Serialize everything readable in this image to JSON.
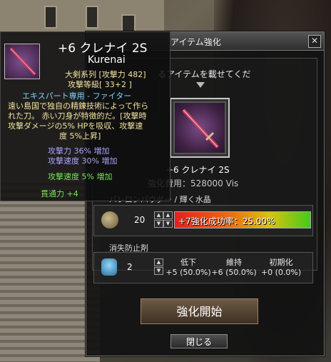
{
  "window": {
    "title": "アイテム強化",
    "close_symbol": "✕",
    "instruction": "るアイテムを載せてくだ"
  },
  "item": {
    "name": "+6 クレナイ 2S",
    "cost_line": "強化費用：528000 Vis"
  },
  "materials": {
    "label": "バレロンパウダー / 輝く水晶",
    "count": "20",
    "success_text": "+7強化成功率：25.00%",
    "success_rate": 0.25
  },
  "protection": {
    "label": "消失防止剤",
    "count": "2",
    "options": [
      {
        "label": "低下",
        "value": "+5 (50.0%)"
      },
      {
        "label": "維持",
        "value": "+6 (50.0%)"
      },
      {
        "label": "初期化",
        "value": "+0 (0.0%)"
      }
    ]
  },
  "buttons": {
    "start": "強化開始",
    "close": "閉じる"
  },
  "stepper": {
    "up": "▲",
    "down": "▼"
  },
  "tooltip": {
    "title": "+6 クレナイ 2S",
    "subtitle": "Kurenai",
    "series": "大剣系列 [攻撃力 482]",
    "grade": "攻撃等級[ 33+2 ]",
    "class": "エキスパート専用 - ファイター",
    "desc1": "遠い島国で独自の精錬技術によって作ら",
    "desc2": "れた刀。 赤い刀身が特徴的だ。[攻撃時",
    "desc3": "攻撃ダメージの5% HPを吸収、攻撃速",
    "desc4": "度 5%上昇]",
    "stat1": "攻撃力 36% 増加",
    "stat2": "攻撃速度 30% 増加",
    "stat3": "攻撃速度 5% 増加",
    "stat4": "貫通力 +4",
    "colors": {
      "white": "#ffffff",
      "yellow": "#f2e3a0",
      "cyan": "#7dd3ff",
      "purple": "#a9a3ff",
      "green": "#78e05a"
    }
  }
}
